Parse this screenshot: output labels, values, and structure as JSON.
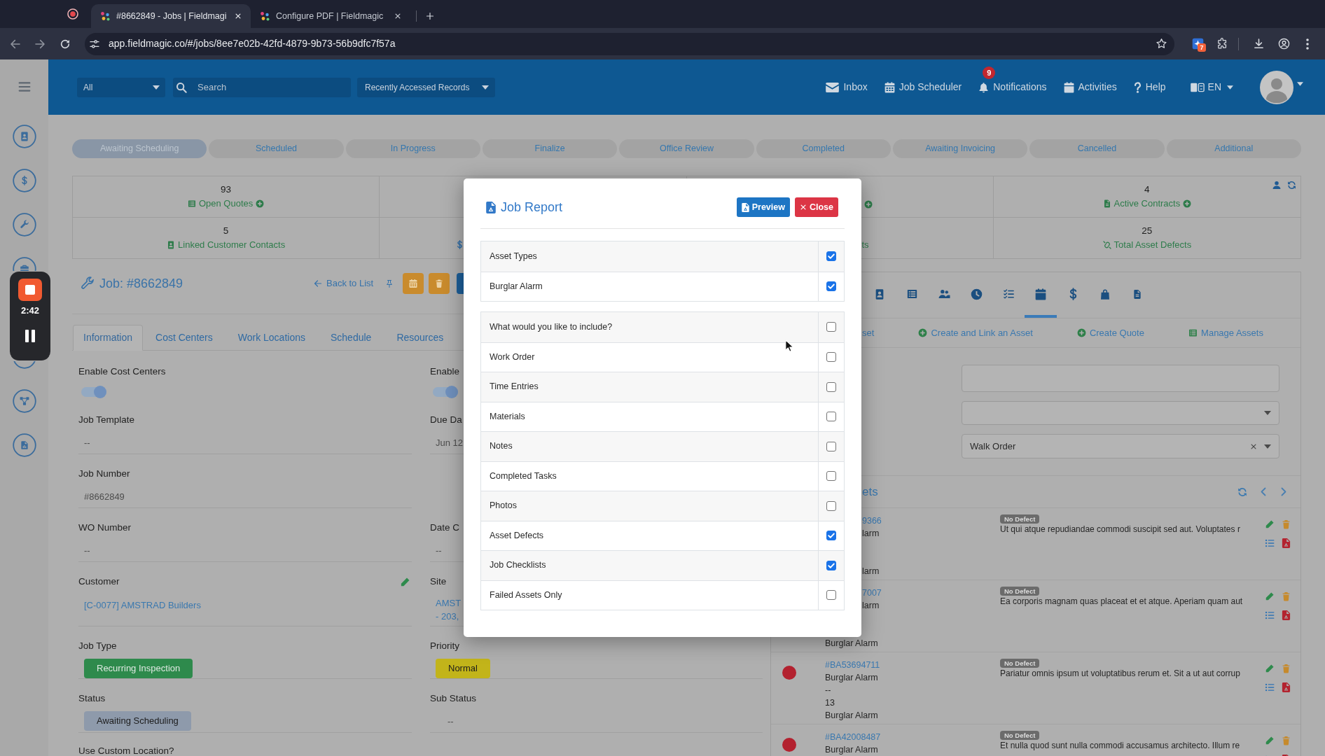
{
  "browser": {
    "tabs": [
      {
        "title": "#8662849 - Jobs | Fieldmagi",
        "selected": true
      },
      {
        "title": "Configure PDF | Fieldmagic",
        "selected": false
      }
    ],
    "url": "app.fieldmagic.co/#/jobs/8ee7e02b-42fd-4879-9b73-56b9dfc7f57a",
    "extension_badge": "7"
  },
  "recorder": {
    "time": "2:42"
  },
  "header": {
    "scope": "All",
    "search_placeholder": "Search",
    "recent": "Recently Accessed Records",
    "nav": [
      {
        "label": "Inbox"
      },
      {
        "label": "Job Scheduler"
      },
      {
        "label": "Notifications",
        "badge": "9"
      },
      {
        "label": "Activities"
      },
      {
        "label": "Help"
      }
    ],
    "language": "EN"
  },
  "status_steps": [
    {
      "label": "Awaiting Scheduling",
      "selected": true
    },
    {
      "label": "Scheduled",
      "selected": false
    },
    {
      "label": "In Progress",
      "selected": false
    },
    {
      "label": "Finalize",
      "selected": false
    },
    {
      "label": "Office Review",
      "selected": false
    },
    {
      "label": "Completed",
      "selected": false
    },
    {
      "label": "Awaiting Invoicing",
      "selected": false
    },
    {
      "label": "Cancelled",
      "selected": false
    },
    {
      "label": "Additional",
      "selected": false
    }
  ],
  "stats": {
    "cells": [
      {
        "value": "93",
        "label": "Open Quotes",
        "add": true
      },
      {
        "value": "4",
        "label": "Active Contracts",
        "add": true
      },
      {
        "value": "5",
        "label": "Linked Customer Contacts",
        "add": false
      },
      {
        "value": "25",
        "label": "Total Asset Defects",
        "add": false
      }
    ],
    "partial_label": "ts"
  },
  "job": {
    "title": "Job: #8662849",
    "back": "Back to List"
  },
  "tabs": [
    {
      "label": "Information",
      "selected": true
    },
    {
      "label": "Cost Centers",
      "selected": false
    },
    {
      "label": "Work Locations",
      "selected": false
    },
    {
      "label": "Schedule",
      "selected": false
    },
    {
      "label": "Resources",
      "selected": false
    }
  ],
  "form_rows": [
    {
      "left": {
        "kind": "toggle",
        "label": "Enable Cost Centers",
        "on": true
      },
      "right": {
        "kind": "toggle",
        "label": "Enable",
        "on": true
      }
    },
    {
      "left": {
        "kind": "text",
        "label": "Job Template",
        "value": "--"
      },
      "right": {
        "kind": "text",
        "label": "Due Da",
        "value": "Jun 12"
      }
    },
    {
      "left": {
        "kind": "text",
        "label": "Job Number",
        "value": "#8662849"
      }
    },
    {
      "left": {
        "kind": "text",
        "label": "WO Number",
        "value": "--"
      },
      "right": {
        "kind": "text",
        "label": "Date C",
        "value": "--"
      }
    },
    {
      "left": {
        "kind": "link",
        "label": "Customer",
        "lines": [
          "[C-0077] AMSTRAD Builders"
        ],
        "editable": true
      },
      "right": {
        "kind": "link",
        "label": "Site",
        "lines": [
          "AMST",
          "- 203,"
        ]
      }
    },
    {
      "left": {
        "kind": "badge",
        "label": "Job Type",
        "value": "Recurring Inspection",
        "color": "#2e8a4c"
      },
      "right": {
        "kind": "badge",
        "label": "Priority",
        "value": "Normal",
        "color": "#c2b41a"
      }
    },
    {
      "left": {
        "kind": "badge",
        "label": "Status",
        "value": "Awaiting Scheduling",
        "color": "#8e9aab"
      },
      "right": {
        "kind": "select",
        "label": "Sub Status",
        "value": "--"
      }
    },
    {
      "left": {
        "kind": "heading",
        "label": "Use Custom Location?"
      }
    }
  ],
  "modal": {
    "title": "Job Report",
    "buttons": [
      {
        "label": "Preview",
        "kind": "preview"
      },
      {
        "label": "Close",
        "kind": "close"
      }
    ],
    "groups": [
      [
        {
          "label": "Asset Types",
          "checked": true
        },
        {
          "label": "Burglar Alarm",
          "checked": true
        }
      ],
      [
        {
          "label": "What would you like to include?",
          "checked": false
        },
        {
          "label": "Work Order",
          "checked": false
        },
        {
          "label": "Time Entries",
          "checked": false
        },
        {
          "label": "Materials",
          "checked": false
        },
        {
          "label": "Notes",
          "checked": false
        },
        {
          "label": "Completed Tasks",
          "checked": false
        },
        {
          "label": "Photos",
          "checked": false
        },
        {
          "label": "Asset Defects",
          "checked": true
        },
        {
          "label": "Job Checklists",
          "checked": true
        },
        {
          "label": "Failed Assets Only",
          "checked": false
        }
      ]
    ]
  },
  "panel": {
    "icon_tabs": [
      {
        "selected": false
      },
      {
        "selected": false
      },
      {
        "selected": false
      },
      {
        "selected": false
      },
      {
        "selected": false
      },
      {
        "selected": true
      },
      {
        "selected": false
      },
      {
        "selected": false
      },
      {
        "selected": false
      }
    ],
    "actions": [
      {
        "label": "set",
        "kind": "text"
      },
      {
        "label": "Create and Link an Asset",
        "kind": "add"
      },
      {
        "label": "Create Quote",
        "kind": "add"
      },
      {
        "label": "Manage Assets",
        "kind": "manage"
      }
    ],
    "filters": [
      {
        "kind": "input"
      },
      {
        "kind": "select"
      },
      {
        "kind": "select",
        "value": "Walk Order",
        "clearable": true
      }
    ],
    "assets_heading": "ets",
    "assets": [
      {
        "code": "9366",
        "line_2": "larm",
        "line_5": "larm",
        "badge": "No Defect",
        "description": "Ut qui atque repudiandae commodi suscipit sed aut. Voluptates r"
      },
      {
        "code": "7007",
        "line_2": "larm",
        "line_5": "Burglar Alarm",
        "badge": "No Defect",
        "description": "Ea corporis magnam quas placeat et et atque. Aperiam quam aut"
      },
      {
        "color": "#b3212f",
        "code": "#BA53694711",
        "line_2": "Burglar Alarm",
        "line_3": "--",
        "line_4": "13",
        "line_5": "Burglar Alarm",
        "badge": "No Defect",
        "description": "Pariatur omnis ipsum ut voluptatibus rerum et. Sit a ut aut corrup"
      },
      {
        "color": "#b3212f",
        "code": "#BA42008487",
        "line_2": "Burglar Alarm",
        "badge": "No Defect",
        "description": "Et nulla quod sunt nulla commodi accusamus architecto. Illum re"
      }
    ]
  }
}
